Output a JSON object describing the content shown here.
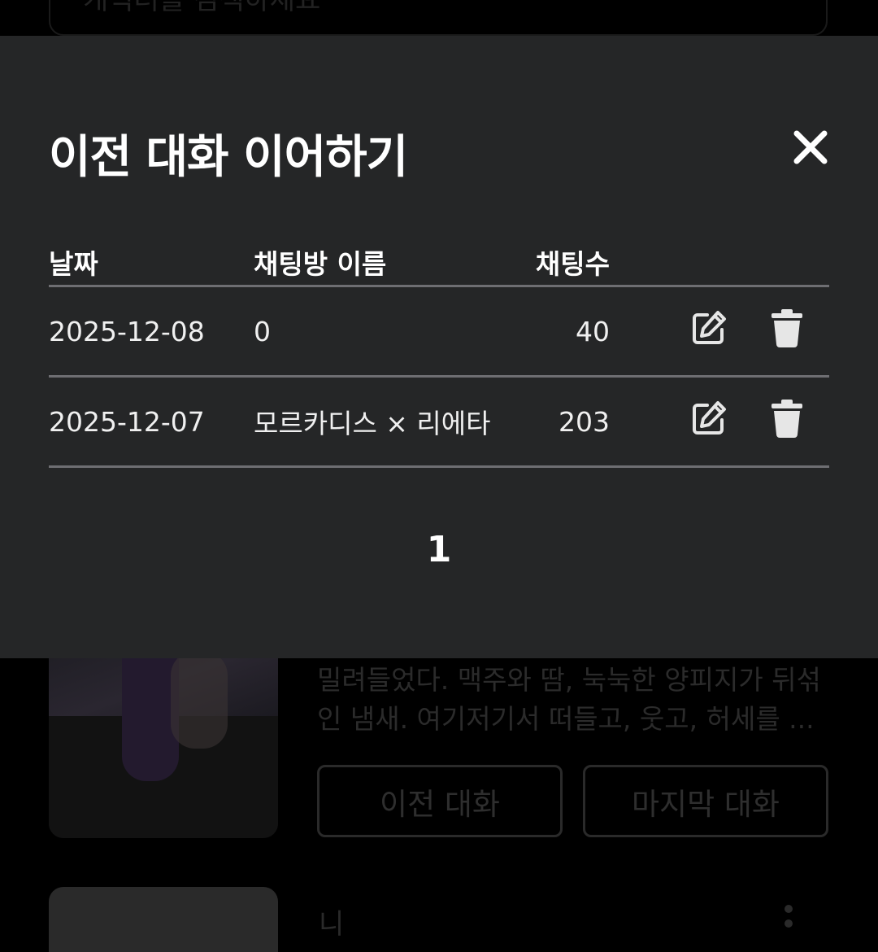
{
  "background": {
    "search_placeholder": "캐릭터를 검색하세요",
    "card": {
      "description": "밀려들었다. 맥주와 땀, 눅눅한 양피지가 뒤섞인 냄새. 여기저기서 떠들고, 웃고, 허세를 ...",
      "prev_button": "이전 대화",
      "last_button": "마지막 대화"
    },
    "card2": {
      "name": "니"
    }
  },
  "modal": {
    "title": "이전 대화 이어하기",
    "columns": {
      "date": "날짜",
      "name": "채팅방 이름",
      "count": "채팅수"
    },
    "rows": [
      {
        "date": "2025-12-08",
        "name": "0",
        "count": "40"
      },
      {
        "date": "2025-12-07",
        "name": "모르카디스 × 리에타",
        "count": "203"
      }
    ],
    "pagination": {
      "current_page": "1"
    }
  },
  "colors": {
    "modal_bg": "#252627",
    "divider": "#6e6e72",
    "text": "#ffffff",
    "icon": "#e6e6e6"
  },
  "icons": [
    "search-icon",
    "close-icon",
    "edit-icon",
    "trash-icon",
    "more-icon"
  ]
}
